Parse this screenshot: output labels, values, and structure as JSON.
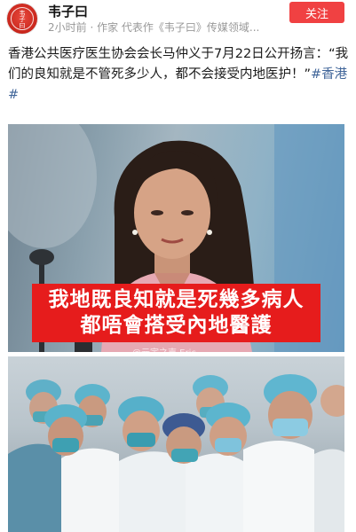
{
  "author": {
    "name": "韦子曰",
    "avatar_icon": "red-seal-avatar-icon",
    "avatar_text": "韦子曰"
  },
  "meta": "2小时前 · 作家 代表作《韦子曰》传媒领域...",
  "follow_label": "关注",
  "colors": {
    "follow_button": "#f04142",
    "hashtag": "#406599",
    "caption_background": "#e61c1c"
  },
  "post": {
    "text": "香港公共医疗医生协会会长马仲义于7月22日公开扬言：“我们的良知就是不管死多少人，都不会接受内地医护！”",
    "hashtags": [
      "#香港#"
    ]
  },
  "images": [
    {
      "caption_lines": [
        "我地既良知就是死幾多病人",
        "都唔會搭受內地醫護"
      ],
      "watermark": "@元宇之声 Eric"
    },
    {}
  ]
}
